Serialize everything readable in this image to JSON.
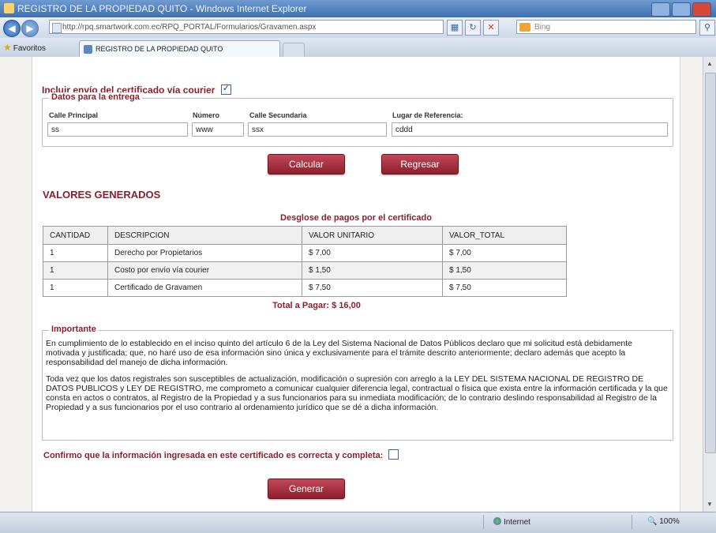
{
  "browser": {
    "window_title": "REGISTRO DE LA PROPIEDAD QUITO - Windows Internet Explorer",
    "address": "http://rpq.smartwork.com.ec/RPQ_PORTAL/Formularios/Gravamen.aspx",
    "search_placeholder": "Bing",
    "favorites_label": "Favoritos",
    "tab_title": "REGISTRO DE LA PROPIEDAD QUITO",
    "status_zone": "Internet",
    "zoom": "100%"
  },
  "courier": {
    "label": "Incluir envío del certificado vía courier",
    "checked": true
  },
  "entrega": {
    "legend": "Datos para la entrega",
    "calle_principal_label": "Calle Principal",
    "calle_principal_value": "ss",
    "numero_label": "Número",
    "numero_value": "www",
    "calle_secundaria_label": "Calle Secundaria",
    "calle_secundaria_value": "ssx",
    "referencia_label": "Lugar de Referencia:",
    "referencia_value": "cddd"
  },
  "buttons": {
    "calcular": "Calcular",
    "regresar": "Regresar",
    "generar": "Generar"
  },
  "valores": {
    "heading": "VALORES GENERADOS",
    "table_title": "Desglose de pagos por el certificado",
    "columns": [
      "CANTIDAD",
      "DESCRIPCION",
      "VALOR UNITARIO",
      "VALOR_TOTAL"
    ],
    "rows": [
      [
        "1",
        "Derecho por Propietarios",
        "$ 7,00",
        "$ 7,00"
      ],
      [
        "1",
        "Costo por envío vía courier",
        "$ 1,50",
        "$ 1,50"
      ],
      [
        "1",
        "Certificado de Gravamen",
        "$ 7,50",
        "$ 7,50"
      ]
    ],
    "total": "Total a Pagar: $ 16,00"
  },
  "importante": {
    "legend": "Importante",
    "paragraph1": "En cumplimiento de lo establecido en el inciso quinto del artículo 6 de la Ley del Sistema Nacional de Datos Públicos declaro que mi solicitud está debidamente motivada y justificada; que, no haré uso de esa información sino única y exclusivamente para el trámite descrito anteriormente; declaro además que acepto la responsabilidad del manejo de dicha información.",
    "paragraph2": "Toda vez que los datos registrales son susceptibles de actualización, modificación o supresión con arreglo a la LEY DEL SISTEMA NACIONAL DE REGISTRO DE DATOS PUBLICOS y LEY DE REGISTRO, me comprometo a comunicar cualquier diferencia legal, contractual o física que exista entre la información certificada y la que consta en actos o contratos, al Registro de la Propiedad y a sus funcionarios para su inmediata modificación; de lo contrario deslindo responsabilidad al Registro de la Propiedad y a sus funcionarios por el uso contrario al ordenamiento jurídico que se dé a dicha información."
  },
  "confirm": {
    "label": "Confirmo que la información ingresada en este certificado es correcta y completa:",
    "checked": false
  },
  "colors": {
    "brand": "#8c1f2b",
    "button_top": "#c4475a"
  },
  "icons": {
    "back": "back-arrow-icon",
    "forward": "forward-arrow-icon",
    "refresh": "refresh-icon",
    "stop": "stop-icon",
    "favorites": "star-icon"
  }
}
